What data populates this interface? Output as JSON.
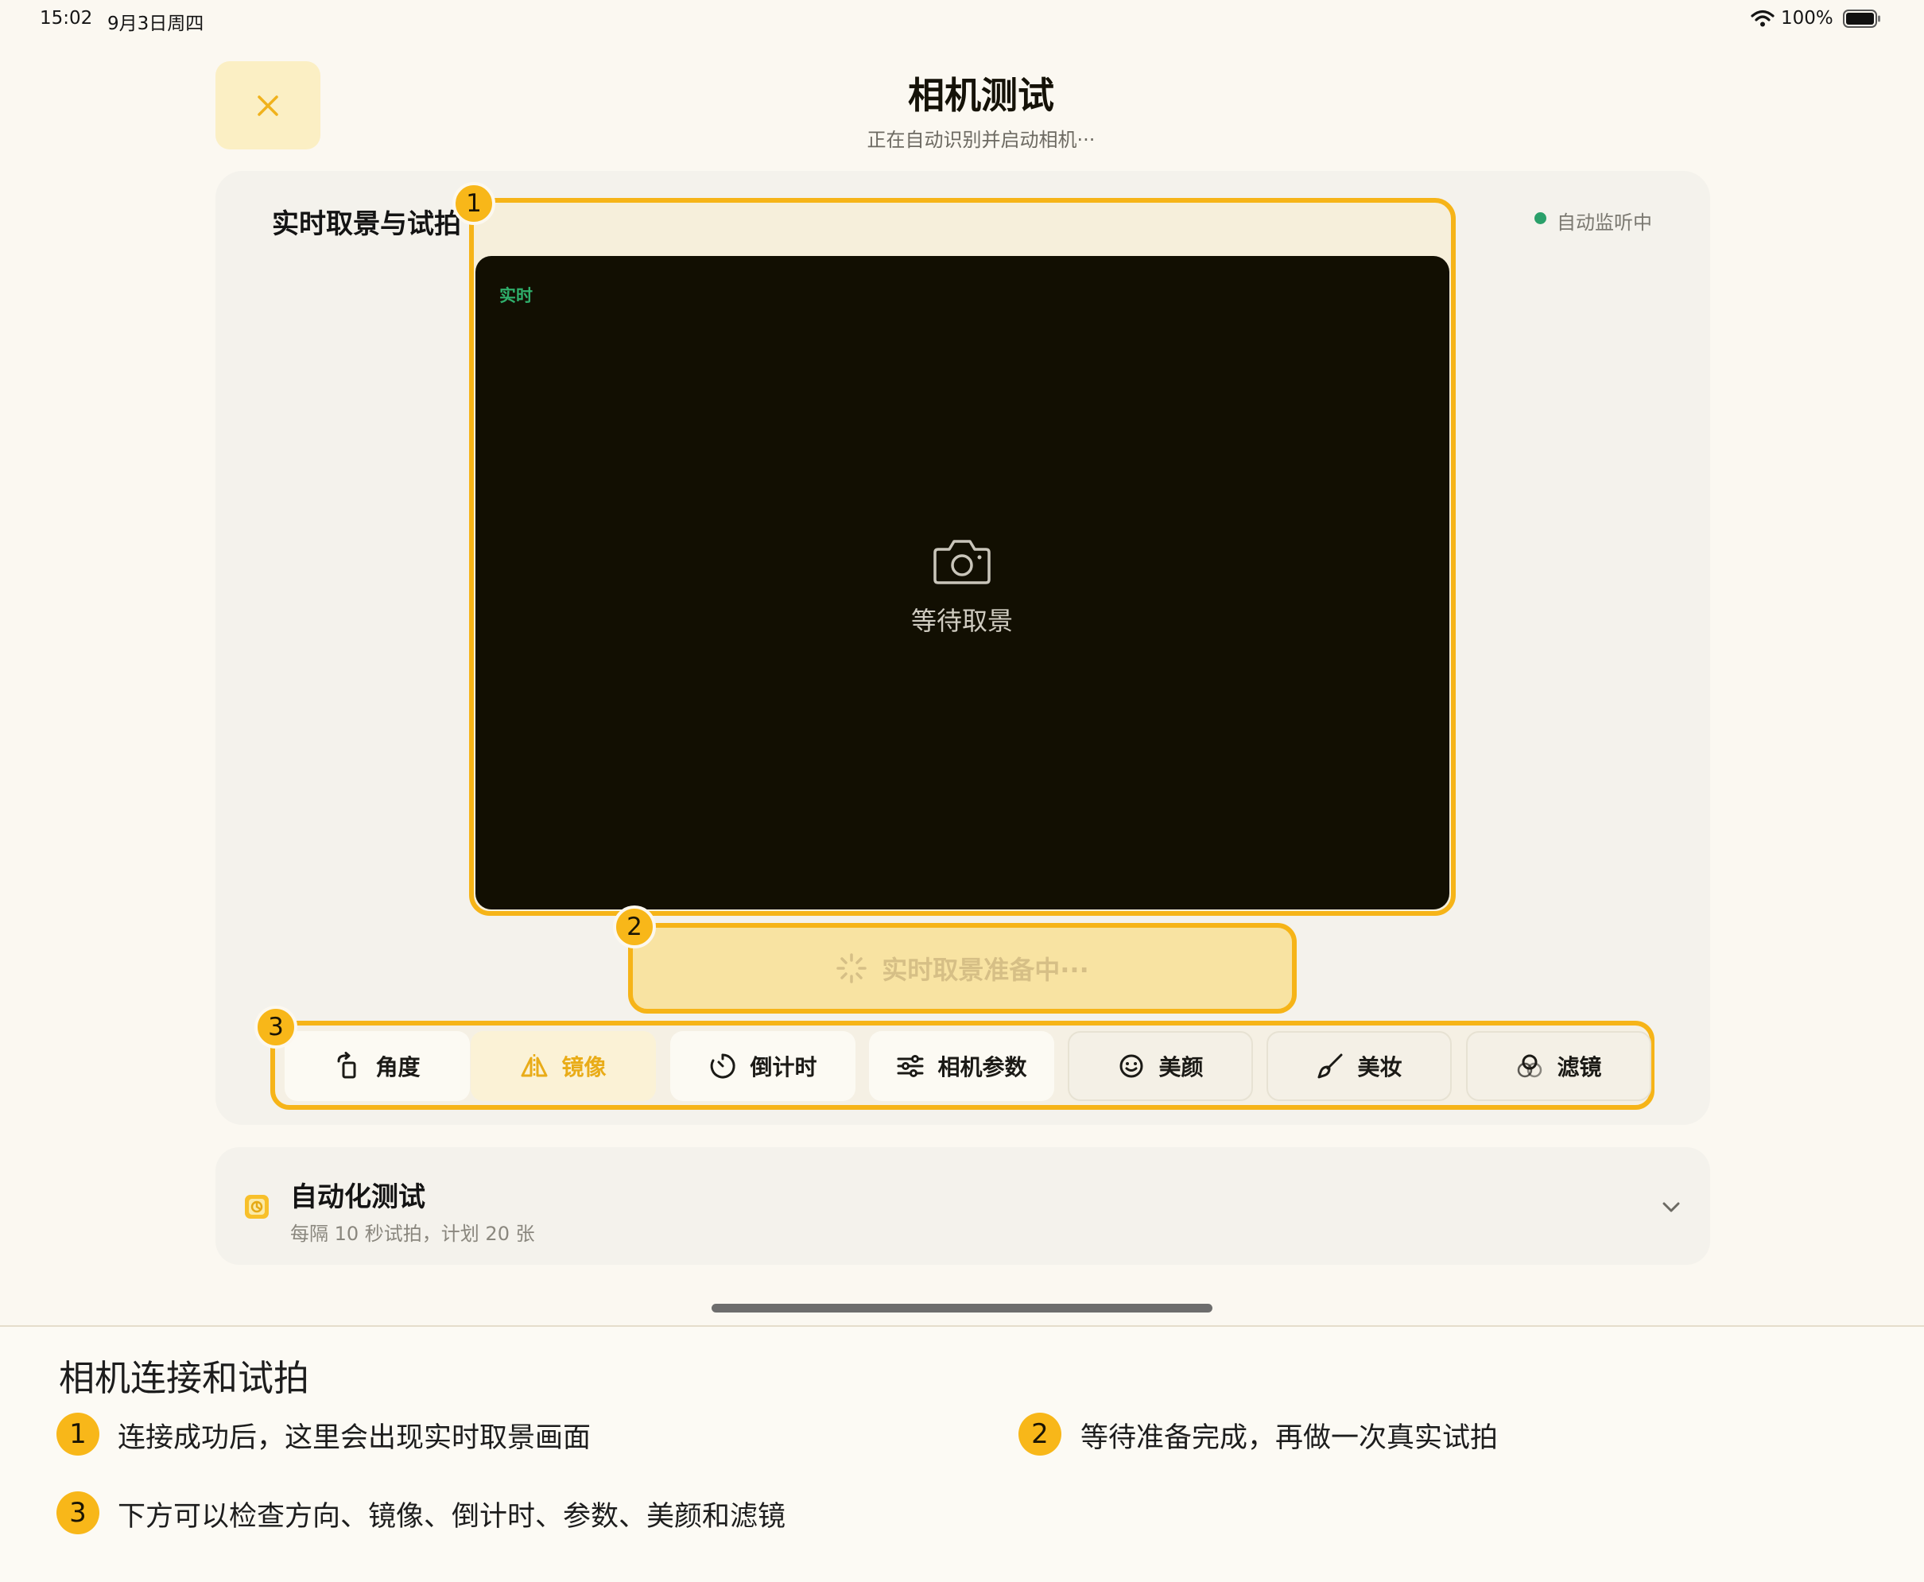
{
  "status_bar": {
    "time": "15:02",
    "date": "9月3日周四",
    "battery": "100%"
  },
  "header": {
    "title": "相机测试",
    "subtitle": "正在自动识别并启动相机···"
  },
  "live_section": {
    "title": "实时取景与试拍",
    "monitor_status": "自动监听中",
    "live_tag": "实时",
    "waiting_text": "等待取景",
    "prepare_button": "实时取景准备中···"
  },
  "toolbar": {
    "items": [
      {
        "label": "角度",
        "icon": "rotate-icon"
      },
      {
        "label": "镜像",
        "icon": "mirror-icon"
      },
      {
        "label": "倒计时",
        "icon": "timer-icon"
      },
      {
        "label": "相机参数",
        "icon": "sliders-icon"
      },
      {
        "label": "美颜",
        "icon": "smile-icon"
      },
      {
        "label": "美妆",
        "icon": "brush-icon"
      },
      {
        "label": "滤镜",
        "icon": "filter-icon"
      }
    ]
  },
  "automation": {
    "title": "自动化测试",
    "subtitle": "每隔 10 秒试拍，计划 20 张"
  },
  "badges": [
    "1",
    "2",
    "3"
  ],
  "annotations": {
    "title": "相机连接和试拍",
    "items": [
      {
        "num": "1",
        "text": "连接成功后，这里会出现实时取景画面"
      },
      {
        "num": "2",
        "text": "等待准备完成，再做一次真实试拍"
      },
      {
        "num": "3",
        "text": "下方可以检查方向、镜像、倒计时、参数、美颜和滤镜"
      }
    ]
  },
  "colors": {
    "accent": "#f6b418",
    "preview_bg": "#120f02",
    "live_green": "#2fae6b"
  }
}
